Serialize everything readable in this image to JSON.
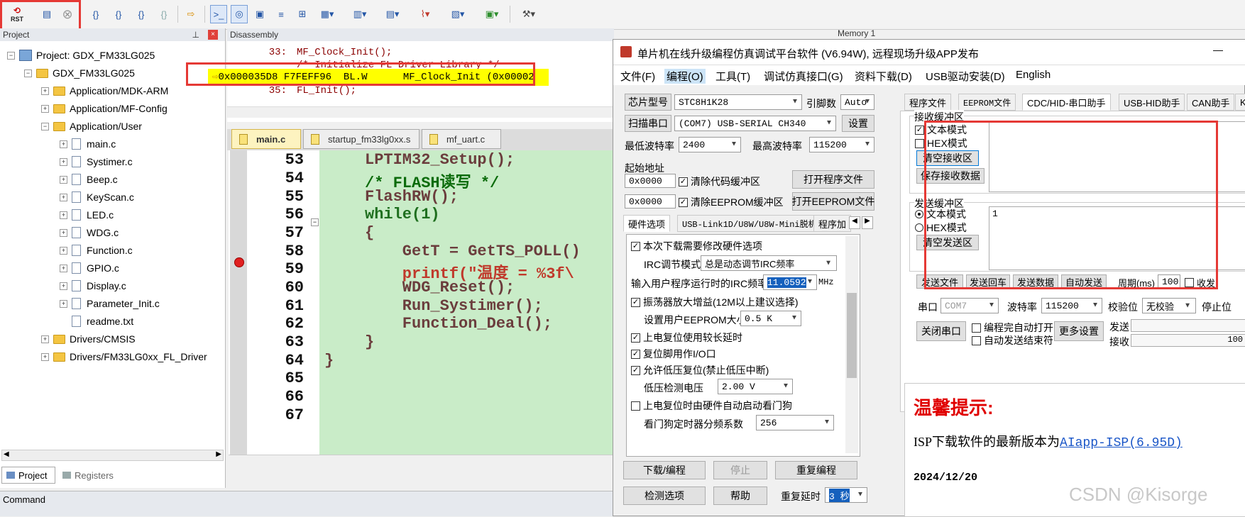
{
  "toolbar": {
    "rst_label": "RST",
    "icons": [
      "reset-icon",
      "load-icon",
      "stop-icon",
      "step-into-icon",
      "step-over-icon",
      "step-out-icon",
      "run-to-cursor-icon",
      "show-next-icon",
      "command-window-icon",
      "disassembly-window-icon",
      "symbols-window-icon",
      "registers-window-icon",
      "call-stack-icon",
      "watch-window-icon",
      "memory-window-icon",
      "serial-window-icon",
      "analysis-window-icon",
      "trace-icon",
      "system-viewer-icon",
      "toolbox-icon"
    ]
  },
  "project_panel": {
    "title": "Project",
    "root": "Project: GDX_FM33LG025",
    "target": "GDX_FM33LG025",
    "groups": [
      "Application/MDK-ARM",
      "Application/MF-Config",
      "Application/User"
    ],
    "files": [
      "main.c",
      "Systimer.c",
      "Beep.c",
      "KeyScan.c",
      "LED.c",
      "WDG.c",
      "Function.c",
      "GPIO.c",
      "Display.c",
      "Parameter_Init.c",
      "readme.txt"
    ],
    "groups_bottom": [
      "Drivers/CMSIS",
      "Drivers/FM33LG0xx_FL_Driver"
    ],
    "tabs": [
      "Project",
      "Registers"
    ]
  },
  "disassembly": {
    "title": "Disassembly",
    "lines": [
      {
        "num": "33:",
        "text": "MF_Clock_Init();"
      },
      {
        "num": "",
        "text": "/* Initialize FL Driver Library */"
      },
      {
        "num": "",
        "text": "0x000035D8 F7FEFF96  BL.W      MF_Clock_Init (0x00002"
      },
      {
        "num": "35:",
        "text": "FL_Init();"
      }
    ]
  },
  "memory_title": "Memory 1",
  "editor": {
    "tabs": [
      "main.c",
      "startup_fm33lg0xx.s",
      "mf_uart.c"
    ],
    "line_numbers": [
      "53",
      "54",
      "55",
      "56",
      "57",
      "58",
      "59",
      "60",
      "61",
      "62",
      "63",
      "64",
      "65",
      "66",
      "67"
    ],
    "code": [
      "LPTIM32_Setup();",
      "/* FLASH读写 */",
      "FlashRW();",
      "while(1)",
      "{",
      "    GetT = GetTS_POLL()",
      "    printf(\"温度 = %3f\\",
      "    WDG_Reset();",
      "    Run_Systimer();",
      "    Function_Deal();",
      "}",
      "}",
      "",
      "",
      ""
    ]
  },
  "command_title": "Command",
  "isp": {
    "title": "单片机在线升级编程仿真调试平台软件 (V6.94W), 远程现场升级APP发布",
    "minimize": "—",
    "menu": [
      "文件(F)",
      "编程(O)",
      "工具(T)",
      "调试仿真接口(G)",
      "资料下载(D)",
      "USB驱动安装(D)",
      "English"
    ],
    "chip_label": "芯片型号",
    "chip_value": "STC8H1K28",
    "pin_label": "引脚数",
    "pin_value": "Auto",
    "scan_label": "扫描串口",
    "port_value": "(COM7) USB-SERIAL CH340",
    "settings_label": "设置",
    "min_baud_label": "最低波特率",
    "min_baud_value": "2400",
    "max_baud_label": "最高波特率",
    "max_baud_value": "115200",
    "start_addr_label": "起始地址",
    "addr1": "0x0000",
    "addr2": "0x0000",
    "clear_code": "清除代码缓冲区",
    "clear_eeprom": "清除EEPROM缓冲区",
    "open_prog": "打开程序文件",
    "open_eeprom": "打开EEPROM文件",
    "hw_tabs": [
      "硬件选项",
      "USB-Link1D/U8W/U8W-Mini脱机",
      "程序加"
    ],
    "hw_options": {
      "modify": "本次下载需要修改硬件选项",
      "irc_mode_label": "IRC调节模式",
      "irc_mode_value": "总是动态调节IRC频率",
      "irc_freq_label": "输入用户程序运行时的IRC频率",
      "irc_freq_value": "11.0592",
      "irc_unit": "MHz",
      "osc_gain": "振荡器放大增益(12M以上建议选择)",
      "eeprom_size_label": "设置用户EEPROM大小",
      "eeprom_size_value": "0.5 K",
      "long_delay": "上电复位使用较长延时",
      "reset_io": "复位脚用作I/O口",
      "low_volt": "允许低压复位(禁止低压中断)",
      "low_volt_label": "低压检测电压",
      "low_volt_value": "2.00 V",
      "wdt_auto": "上电复位时由硬件自动启动看门狗",
      "wdt_div_label": "看门狗定时器分频系数",
      "wdt_div_value": "256"
    },
    "download_btn": "下载/编程",
    "stop_btn": "停止",
    "reprogram_btn": "重复编程",
    "detect_btn": "检测选项",
    "help_btn": "帮助",
    "repeat_delay_label": "重复延时",
    "repeat_delay_value": "3 秒",
    "right_tabs": [
      "程序文件",
      "EEPROM文件",
      "CDC/HID-串口助手",
      "USB-HID助手",
      "CAN助手",
      "K"
    ],
    "recv_group": "接收缓冲区",
    "recv_text_mode": "文本模式",
    "recv_hex_mode": "HEX模式",
    "clear_recv": "清空接收区",
    "save_recv": "保存接收数据",
    "send_group": "发送缓冲区",
    "send_text_mode": "文本模式",
    "send_hex_mode": "HEX模式",
    "clear_send": "清空发送区",
    "send_content": "1",
    "action_row": [
      "发送文件",
      "发送回车",
      "发送数据",
      "自动发送"
    ],
    "period_label": "周期(ms)",
    "period_value": "100",
    "recv_label": "收发",
    "serial_label": "串口",
    "serial_value": "COM7",
    "baud_label": "波特率",
    "baud_value": "115200",
    "parity_label": "校验位",
    "parity_value": "无校验",
    "stopbit_label": "停止位",
    "close_port": "关闭串口",
    "auto_open": "编程完自动打开",
    "auto_end": "自动发送结束符",
    "more_settings": "更多设置",
    "send_count_label": "发送",
    "recv_count_label": "接收",
    "recv_count_value": "100",
    "tip_title": "温馨提示:",
    "tip_text": "ISP下载软件的最新版本为",
    "tip_link": "AIapp-ISP(6.95D)",
    "tip_date": "2024/12/20"
  },
  "watermark": "CSDN @Kisorge",
  "colors": {
    "red_box": "#e53935",
    "highlight": "#ffff00",
    "editor_bg": "#c9ecc8",
    "link": "#1a56c8",
    "tip_red": "#e00000"
  }
}
